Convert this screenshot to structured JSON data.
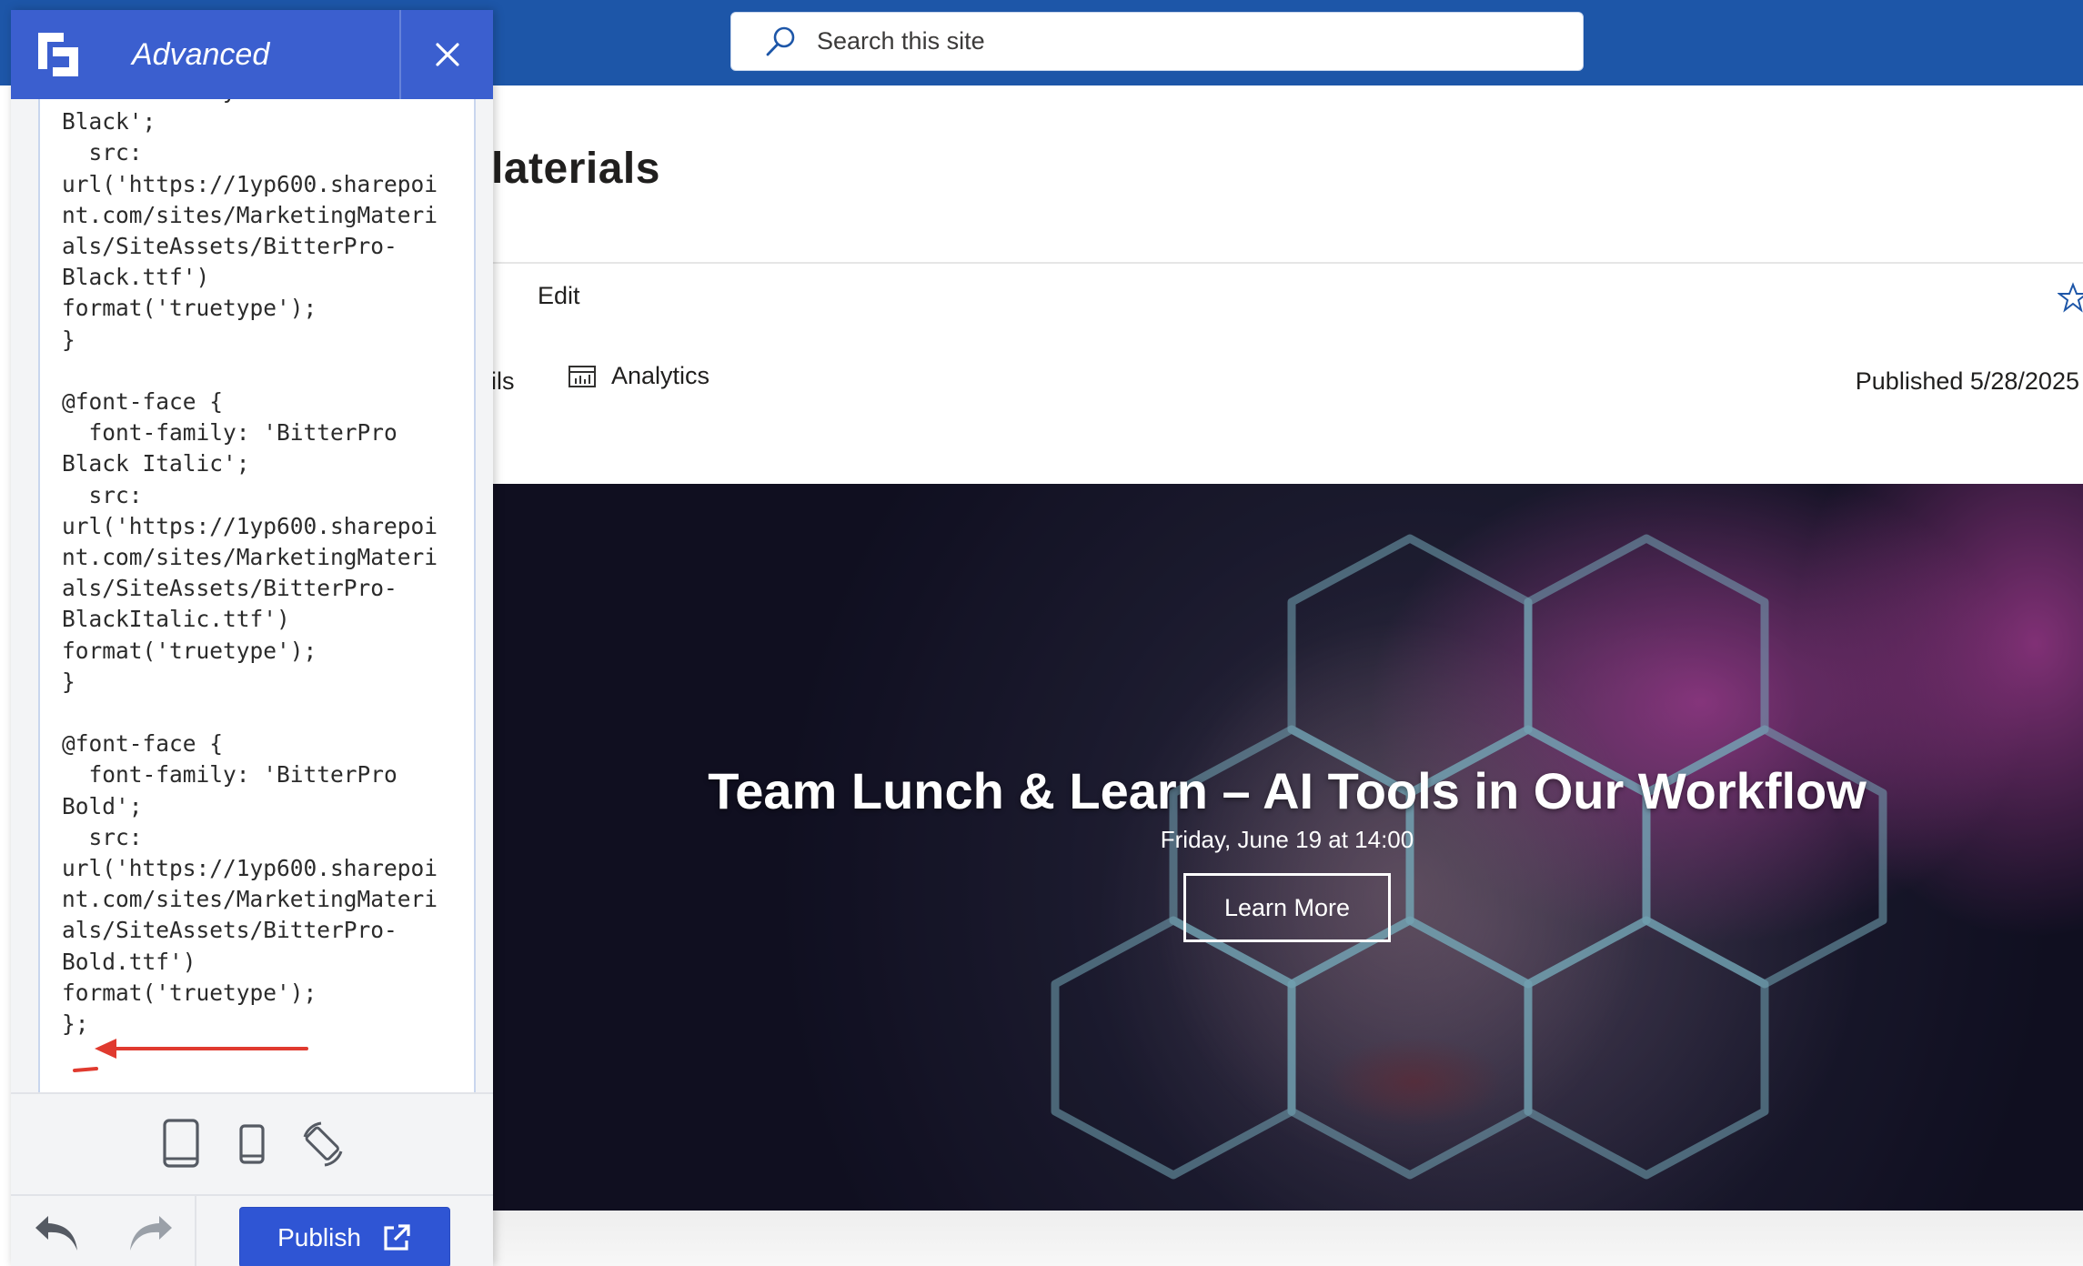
{
  "search": {
    "placeholder": "Search this site"
  },
  "site": {
    "title_fragment": "laterials"
  },
  "command_bar": {
    "edit_label": "Edit"
  },
  "page_meta": {
    "details_fragment": "ils",
    "analytics_label": "Analytics",
    "published_label": "Published 5/28/2025"
  },
  "hero": {
    "title": "Team Lunch & Learn – AI Tools in Our Workflow",
    "subtitle": "Friday, June 19 at 14:00",
    "cta_label": "Learn More"
  },
  "panel": {
    "title": "Advanced",
    "code": "  font-family: 'BitterPro\nBlack';\n  src:\nurl('https://1yp600.sharepoi\nnt.com/sites/MarketingMateri\nals/SiteAssets/BitterPro-\nBlack.ttf')\nformat('truetype');\n}\n\n@font-face {\n  font-family: 'BitterPro\nBlack Italic';\n  src:\nurl('https://1yp600.sharepoi\nnt.com/sites/MarketingMateri\nals/SiteAssets/BitterPro-\nBlackItalic.ttf')\nformat('truetype');\n}\n\n@font-face {\n  font-family: 'BitterPro\nBold';\n  src:\nurl('https://1yp600.sharepoi\nnt.com/sites/MarketingMateri\nals/SiteAssets/BitterPro-\nBold.ttf')\nformat('truetype');\n};",
    "publish_label": "Publish"
  },
  "icons": {
    "logo": "logo-icon",
    "close": "close-icon",
    "search": "search-icon",
    "star": "star-icon",
    "analytics": "analytics-icon",
    "tablet": "tablet-icon",
    "phone": "phone-icon",
    "rotate": "rotate-icon",
    "undo": "undo-icon",
    "redo": "redo-icon",
    "external": "external-link-icon",
    "annotation_arrow": "red-arrow-annotation"
  },
  "colors": {
    "suite_bar": "#1d56a8",
    "panel_header": "#3b5fcf",
    "publish_button": "#2f55d4",
    "annotation": "#e03a2f"
  }
}
